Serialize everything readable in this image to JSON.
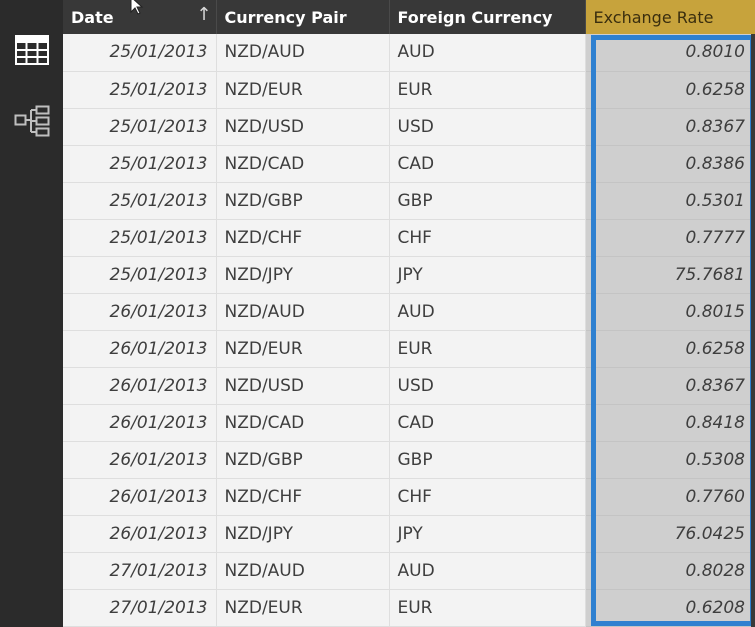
{
  "icons": {
    "rail_top": "table-grid-icon",
    "rail_bottom": "relationships-icon",
    "cursor": "mouse-pointer-icon",
    "sort": "sort-ascending-arrow-icon"
  },
  "colors": {
    "rail_bg": "#2b2b2b",
    "header_bg": "#383838",
    "selected_header_bg": "#c7a33c",
    "selected_column_bg": "#cfcfcf",
    "selection_border": "#2f80d0"
  },
  "table": {
    "columns": [
      "Date",
      "Currency Pair",
      "Foreign Currency",
      "Exchange Rate"
    ],
    "sort_indicator": "↑",
    "rows": [
      [
        "25/01/2013",
        "NZD/AUD",
        "AUD",
        "0.8010"
      ],
      [
        "25/01/2013",
        "NZD/EUR",
        "EUR",
        "0.6258"
      ],
      [
        "25/01/2013",
        "NZD/USD",
        "USD",
        "0.8367"
      ],
      [
        "25/01/2013",
        "NZD/CAD",
        "CAD",
        "0.8386"
      ],
      [
        "25/01/2013",
        "NZD/GBP",
        "GBP",
        "0.5301"
      ],
      [
        "25/01/2013",
        "NZD/CHF",
        "CHF",
        "0.7777"
      ],
      [
        "25/01/2013",
        "NZD/JPY",
        "JPY",
        "75.7681"
      ],
      [
        "26/01/2013",
        "NZD/AUD",
        "AUD",
        "0.8015"
      ],
      [
        "26/01/2013",
        "NZD/EUR",
        "EUR",
        "0.6258"
      ],
      [
        "26/01/2013",
        "NZD/USD",
        "USD",
        "0.8367"
      ],
      [
        "26/01/2013",
        "NZD/CAD",
        "CAD",
        "0.8418"
      ],
      [
        "26/01/2013",
        "NZD/GBP",
        "GBP",
        "0.5308"
      ],
      [
        "26/01/2013",
        "NZD/CHF",
        "CHF",
        "0.7760"
      ],
      [
        "26/01/2013",
        "NZD/JPY",
        "JPY",
        "76.0425"
      ],
      [
        "27/01/2013",
        "NZD/AUD",
        "AUD",
        "0.8028"
      ],
      [
        "27/01/2013",
        "NZD/EUR",
        "EUR",
        "0.6208"
      ]
    ]
  }
}
